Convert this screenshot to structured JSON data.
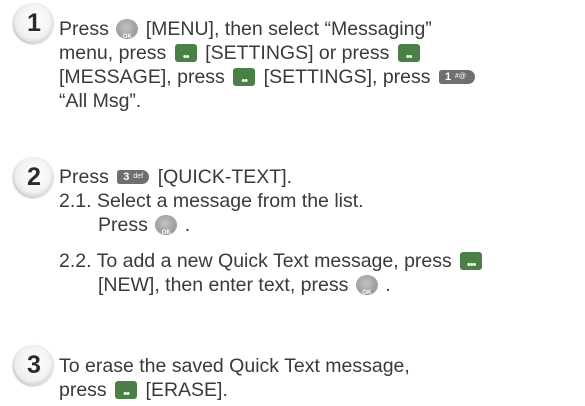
{
  "steps": [
    {
      "number": "1",
      "lines": [
        [
          "Press",
          "[MENU], then select “Messaging”"
        ],
        [
          "menu, press",
          "[SETTINGS] or press"
        ],
        [
          "[MESSAGE], press",
          "[SETTINGS], press"
        ],
        [
          "“All Msg”."
        ]
      ],
      "keys": [
        "ok-key",
        "right-soft-key",
        "right-soft-key",
        "right-soft-key",
        "1-key"
      ]
    },
    {
      "number": "2",
      "main": [
        "Press",
        "[QUICK-TEXT]."
      ],
      "keys": [
        "3-key"
      ],
      "sub_items": [
        {
          "label": "2.1.",
          "lines": [
            "Select a message from the list.",
            "Press",
            "."
          ]
        },
        {
          "label": "2.2.",
          "lines": [
            "To add a new Quick Text message, press",
            "[NEW], then enter text, press",
            "."
          ]
        }
      ]
    },
    {
      "number": "3",
      "lines": [
        [
          "To erase the saved Quick Text message,"
        ],
        [
          "press",
          "[ERASE]."
        ]
      ]
    }
  ],
  "key_labels": {
    "ok": "OK",
    "one_digit": "1",
    "one_symbols": "#@",
    "three_digit": "3",
    "three_letters": "def"
  },
  "colors": {
    "soft_key": "#4a7f46",
    "ok_key": "#9a9a9a",
    "number_key": "#6f6f6f",
    "text": "#3a3a3a"
  }
}
